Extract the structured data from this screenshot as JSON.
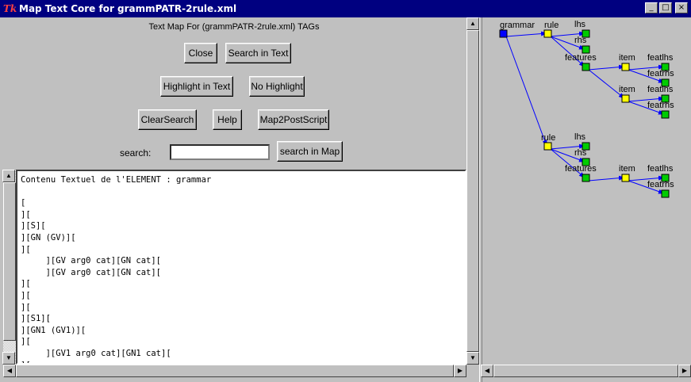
{
  "window": {
    "title": "Map Text Core for grammPATR-2rule.xml",
    "app_icon": "Tk",
    "controls": {
      "minimize": "_",
      "maximize": "□",
      "close": "×"
    }
  },
  "left": {
    "map_title": "Text Map For (grammPATR-2rule.xml) TAGs",
    "buttons": {
      "close": "Close",
      "search_in_text": "Search in Text",
      "highlight_in_text": "Highlight in Text",
      "no_highlight": "No Highlight",
      "clear_search": "ClearSearch",
      "help": "Help",
      "map2postscript": "Map2PostScript",
      "search_in_map": "search in Map"
    },
    "search_label": "search:",
    "search_value": "",
    "text_lines": [
      "Contenu Textuel de l'ELEMENT : grammar",
      "",
      "[",
      "][",
      "][S][",
      "][GN (GV)][",
      "][",
      "     ][GV arg0 cat][GN cat][",
      "     ][GV arg0 cat][GN cat][",
      "][",
      "][",
      "][",
      "][S1][",
      "][GN1 (GV1)][",
      "][",
      "     ][GV1 arg0 cat][GN1 cat][",
      "]["
    ]
  },
  "tree": {
    "colors": {
      "root": "#0000ff",
      "element": "#ffff00",
      "leaf": "#00cc00",
      "edge": "#0000ff"
    },
    "labels": {
      "grammar": "grammar",
      "rule1": "rule",
      "lhs1": "lhs",
      "rhs1": "rhs",
      "features1": "features",
      "item1a": "item",
      "featlhs1a": "featlhs",
      "featrhs1a": "featrhs",
      "item1b": "item",
      "featlhs1b": "featlhs",
      "featrhs1b": "featrhs",
      "rule2": "rule",
      "lhs2": "lhs",
      "rhs2": "rhs",
      "features2": "features",
      "item2": "item",
      "featlhs2": "featlhs",
      "featrhs2": "featrhs"
    }
  }
}
